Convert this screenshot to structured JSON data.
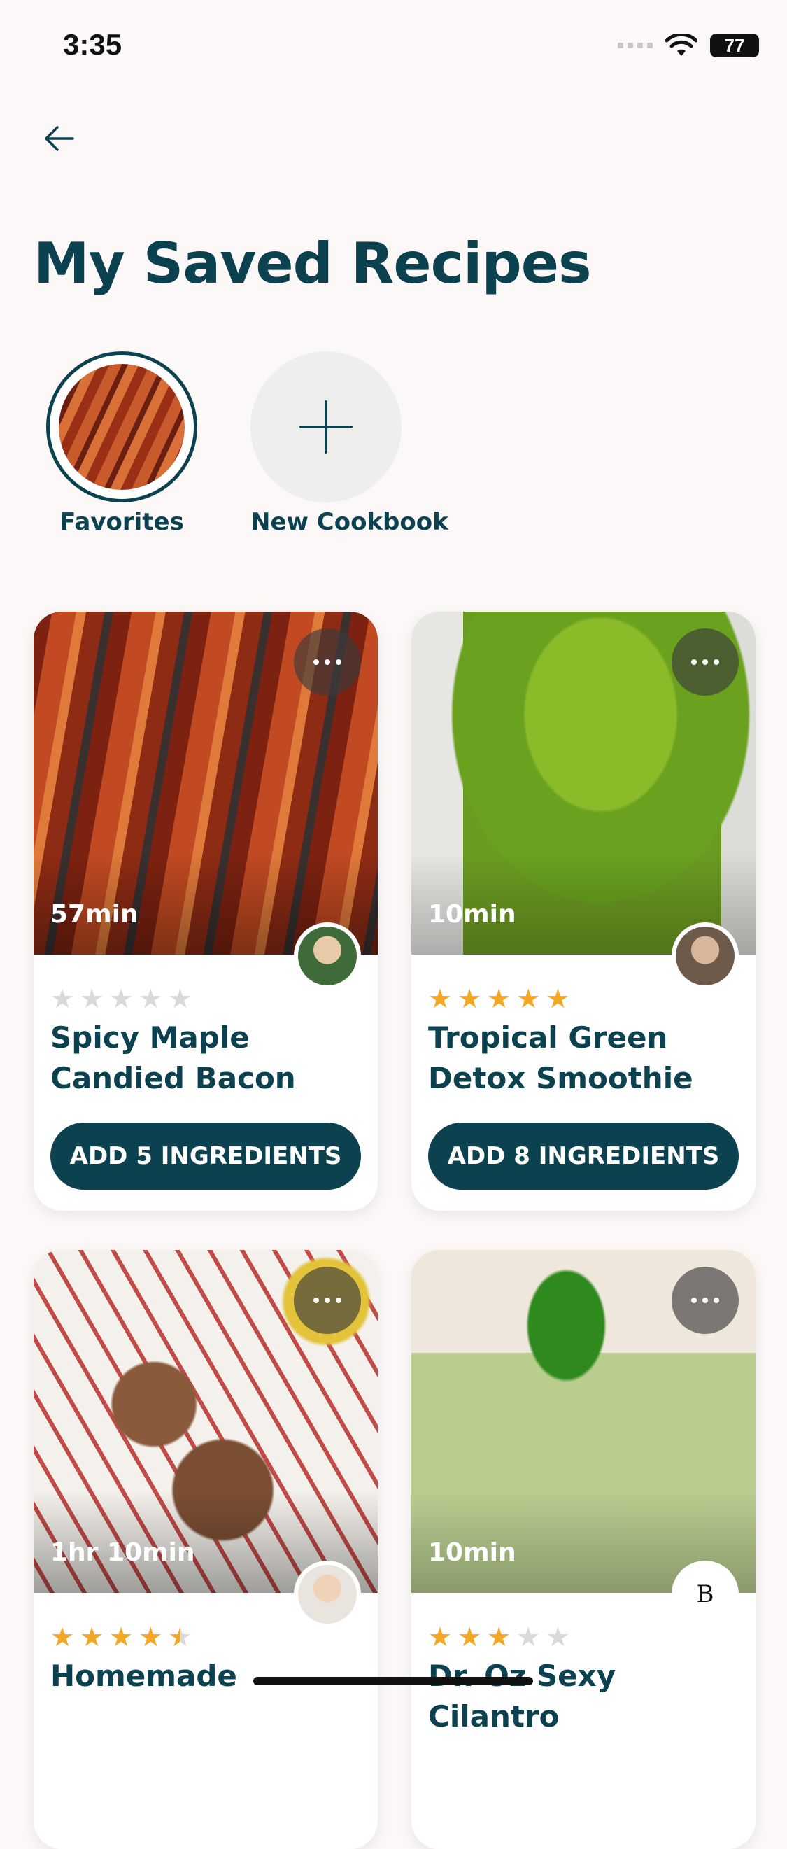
{
  "status": {
    "time": "3:35",
    "battery": "77"
  },
  "header": {
    "title": "My Saved Recipes"
  },
  "cookbooks": [
    {
      "label": "Favorites"
    },
    {
      "label": "New Cookbook"
    }
  ],
  "recipes": [
    {
      "time": "57min",
      "name": "Spicy Maple Candied Bacon",
      "rating": 0,
      "button": "ADD 5 INGREDIENTS"
    },
    {
      "time": "10min",
      "name": "Tropical Green Detox Smoothie",
      "rating": 5,
      "button": "ADD 8 INGREDIENTS"
    },
    {
      "time": "1hr 10min",
      "name": "Homemade",
      "rating": 4.5,
      "button": ""
    },
    {
      "time": "10min",
      "name": "Dr. Oz Sexy Cilantro",
      "rating": 3,
      "button": "",
      "author_initials": "B"
    }
  ],
  "colors": {
    "brand": "#0c4150",
    "star": "#f3a722",
    "background": "#fcf8f7"
  }
}
